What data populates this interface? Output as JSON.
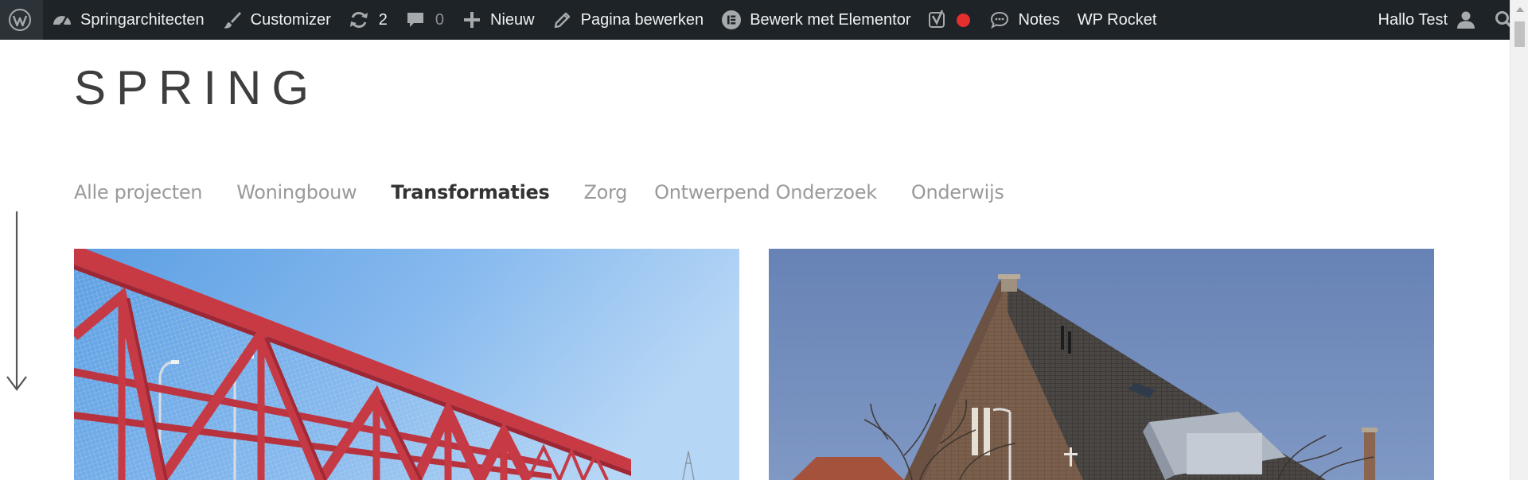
{
  "adminbar": {
    "site_name": "Springarchitecten",
    "customizer": "Customizer",
    "updates_count": "2",
    "comments_count": "0",
    "new_label": "Nieuw",
    "edit_page": "Pagina bewerken",
    "elementor": "Bewerk met Elementor",
    "notes": "Notes",
    "wp_rocket": "WP Rocket",
    "greeting": "Hallo Test",
    "colors": {
      "bar": "#1d2327",
      "text": "#f0f0f1",
      "icon": "#a7aaad",
      "record": "#e52e2e"
    }
  },
  "site": {
    "logo": "SPRING"
  },
  "nav": {
    "items": [
      {
        "label": "Alle projecten",
        "active": false
      },
      {
        "label": "Woningbouw",
        "active": false
      },
      {
        "label": "Transformaties",
        "active": true
      },
      {
        "label": "Zorg",
        "active": false
      },
      {
        "label": "Ontwerpend Onderzoek",
        "active": false
      },
      {
        "label": "Onderwijs",
        "active": false
      }
    ]
  },
  "projects": [
    {
      "image": "red-steel-truss-bridge-photo"
    },
    {
      "image": "brick-church-gable-photo"
    }
  ],
  "icons": {
    "wordpress": "wordpress-logo-icon",
    "dashboard": "dashboard-icon",
    "customizer": "paintbrush-icon",
    "updates": "refresh-icon",
    "comments": "comment-icon",
    "new": "plus-icon",
    "edit": "pencil-icon",
    "elementor": "elementor-icon",
    "yoast": "yoast-icon",
    "notes": "speech-bubble-icon",
    "user": "user-icon",
    "search": "search-icon",
    "scroll": "down-arrow-icon"
  }
}
